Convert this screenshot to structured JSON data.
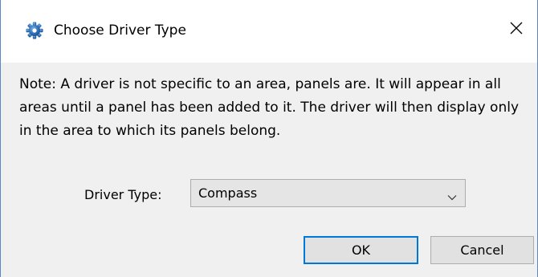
{
  "dialog": {
    "title": "Choose Driver Type",
    "close_icon": "close-icon",
    "app_icon": "gear-icon"
  },
  "note": {
    "text": "Note: A driver is not specific to an area, panels are. It will appear in all areas until a panel has been added to it. The driver will then display only in the area to which its panels belong."
  },
  "driver_type": {
    "label": "Driver Type:",
    "selected": "Compass"
  },
  "buttons": {
    "ok_label": "OK",
    "cancel_label": "Cancel"
  },
  "colors": {
    "accent": "#0078d7",
    "content_bg": "#f0f0f0",
    "window_border": "#5a88c6"
  }
}
